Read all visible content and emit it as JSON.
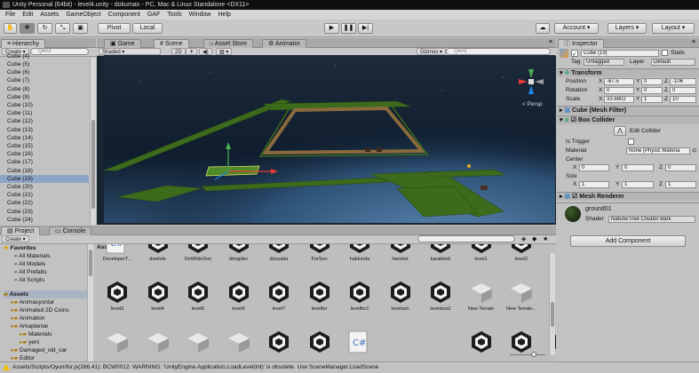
{
  "window": {
    "title": "Unity Personal (64bit) - level4.unity - dokuman - PC, Mac & Linux Standalone <DX11>"
  },
  "menu": [
    "File",
    "Edit",
    "Assets",
    "GameObject",
    "Component",
    "GAF",
    "Tools",
    "Window",
    "Help"
  ],
  "toolbar": {
    "pivot": "Pivot",
    "local": "Local",
    "account": "Account",
    "layers": "Layers",
    "layout": "Layout"
  },
  "hierarchy": {
    "tab": "Hierarchy",
    "create": "Create",
    "search": "Q▾All",
    "items": [
      "Cube (5)",
      "Cube (6)",
      "Cube (7)",
      "Cube (8)",
      "Cube (9)",
      "Cube (10)",
      "Cube (11)",
      "Cube (12)",
      "Cube (13)",
      "Cube (14)",
      "Cube (15)",
      "Cube (16)",
      "Cube (17)",
      "Cube (18)",
      "Cube (19)",
      "Cube (20)",
      "Cube (21)",
      "Cube (22)",
      "Cube (23)",
      "Cube (24)"
    ],
    "selected_index": 14,
    "top_item": "Cube (4)"
  },
  "scene_tabs": {
    "game": "Game",
    "scene": "Scene",
    "asset_store": "Asset Store",
    "animator": "Animator"
  },
  "scene_bar": {
    "shaded": "Shaded",
    "mode_2d": "2D",
    "gizmos": "Gizmos",
    "search": "Q▾All",
    "persp": "< Persp"
  },
  "inspector": {
    "tab": "Inspector",
    "name": "Cube (19)",
    "static": "Static",
    "tag_label": "Tag",
    "tag": "Untagged",
    "layer_label": "Layer",
    "layer": "Default",
    "transform": {
      "title": "Transform",
      "position": {
        "label": "Position",
        "x": "-67.5",
        "y": "0",
        "z": "-106"
      },
      "rotation": {
        "label": "Rotation",
        "x": "0",
        "y": "0",
        "z": "0"
      },
      "scale": {
        "label": "Scale",
        "x": "33.6802",
        "y": "1",
        "z": "10"
      }
    },
    "mesh_filter": {
      "title": "Cube (Mesh Filter)"
    },
    "box_collider": {
      "title": "Box Collider",
      "edit": "Edit Collider",
      "is_trigger": "Is Trigger",
      "material_label": "Material",
      "material": "None (Physic Materia",
      "center_label": "Center",
      "center": {
        "x": "0",
        "y": "0",
        "z": "0"
      },
      "size_label": "Size",
      "size": {
        "x": "1",
        "y": "1",
        "z": "1"
      }
    },
    "mesh_renderer": {
      "title": "Mesh Renderer"
    },
    "material": {
      "name": "ground01",
      "shader_label": "Shader",
      "shader": "Nature/Tree Creator Bark"
    },
    "add_component": "Add Component"
  },
  "project": {
    "tabs": {
      "project": "Project",
      "console": "Console"
    },
    "create": "Create",
    "favorites": {
      "title": "Favorites",
      "items": [
        "All Materials",
        "All Models",
        "All Prefabs",
        "All Scripts"
      ]
    },
    "assets_title": "Assets",
    "folders": [
      "Animasyonlar",
      "Animated 2D Coins",
      "Animation",
      "Arkaplanlar",
      "Materials",
      "yeni",
      "Damaged_old_car",
      "Editor"
    ],
    "breadcrumb": "Assets",
    "row1": [
      "DeveloperT...",
      "dowhile",
      "DoWhileSon",
      "döngüler",
      "dünyalar",
      "ForSon",
      "hakkında",
      "hareket",
      "karakterk",
      "level1",
      "level2"
    ],
    "row2": [
      "level3",
      "level4",
      "level5",
      "level6",
      "level7",
      "levelfor",
      "levelfor1",
      "levelson",
      "levelson2",
      "New Terrain",
      "New Terrain..."
    ]
  },
  "status": {
    "message": "Assets/Scripts/Oyun/for.js(266,41): BCW0012: WARNING: 'UnityEngine.Application.LoadLevel(int)' is obsolete. Use SceneManager.LoadScene"
  },
  "colors": {
    "selection": "#8fa5c7",
    "scene_bg": "#0d1a2a",
    "grass": "#3f6b1e",
    "dirt": "#8a6a3c"
  }
}
